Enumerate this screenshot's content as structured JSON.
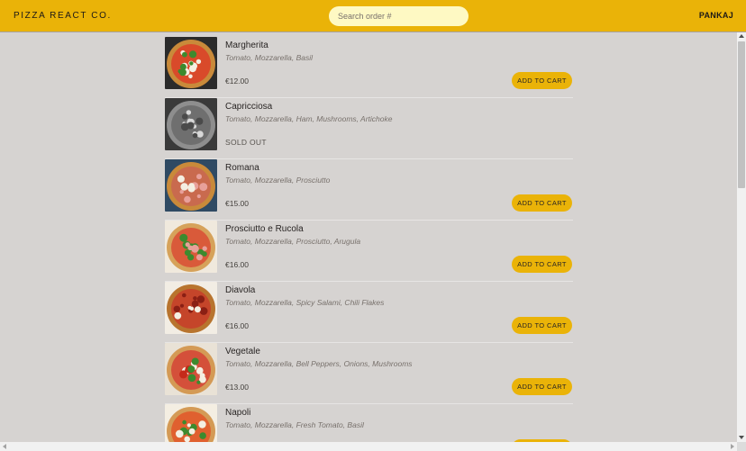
{
  "header": {
    "brand": "PIZZA REACT CO.",
    "search_placeholder": "Search order #",
    "username": "PANKAJ"
  },
  "menu": {
    "add_to_cart_label": "ADD TO CART",
    "sold_out_label": "SOLD OUT",
    "items": [
      {
        "name": "Margherita",
        "ingredients": "Tomato, Mozzarella, Basil",
        "price": "€12.00",
        "sold_out": false
      },
      {
        "name": "Capricciosa",
        "ingredients": "Tomato, Mozzarella, Ham, Mushrooms, Artichoke",
        "price": "",
        "sold_out": true
      },
      {
        "name": "Romana",
        "ingredients": "Tomato, Mozzarella, Prosciutto",
        "price": "€15.00",
        "sold_out": false
      },
      {
        "name": "Prosciutto e Rucola",
        "ingredients": "Tomato, Mozzarella, Prosciutto, Arugula",
        "price": "€16.00",
        "sold_out": false
      },
      {
        "name": "Diavola",
        "ingredients": "Tomato, Mozzarella, Spicy Salami, Chili Flakes",
        "price": "€16.00",
        "sold_out": false
      },
      {
        "name": "Vegetale",
        "ingredients": "Tomato, Mozzarella, Bell Peppers, Onions, Mushrooms",
        "price": "€13.00",
        "sold_out": false
      },
      {
        "name": "Napoli",
        "ingredients": "Tomato, Mozzarella, Fresh Tomato, Basil",
        "price": "",
        "sold_out": false
      }
    ]
  },
  "colors": {
    "accent": "#eab308",
    "background": "#d6d3d1",
    "search_bg": "#fef9c3"
  }
}
